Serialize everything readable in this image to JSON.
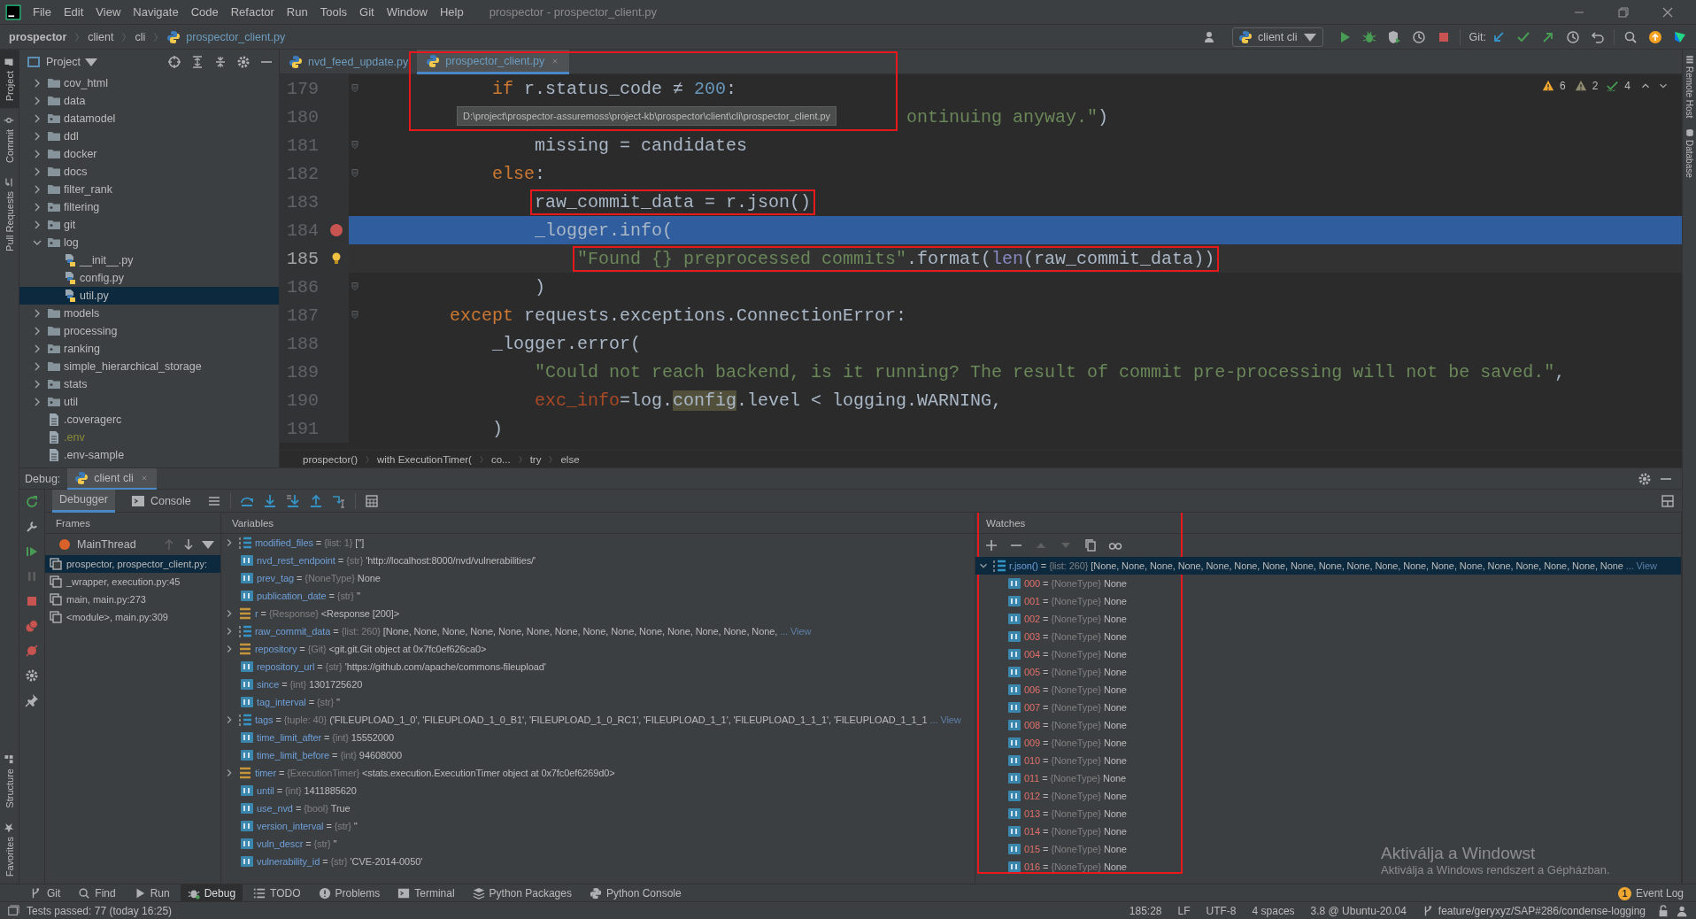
{
  "menu": [
    "File",
    "Edit",
    "View",
    "Navigate",
    "Code",
    "Refactor",
    "Run",
    "Tools",
    "Git",
    "Window",
    "Help"
  ],
  "window_title": "prospector - prospector_client.py",
  "nav": {
    "crumbs": [
      "prospector",
      "client",
      "cli",
      "prospector_client.py"
    ],
    "run_config": "client cli",
    "git_label": "Git:"
  },
  "left_strip": {
    "top": [
      {
        "label": "Project",
        "selected": true
      },
      {
        "label": "Commit",
        "selected": false
      },
      {
        "label": "Pull Requests",
        "selected": false
      }
    ],
    "bottom": [
      {
        "label": "Structure",
        "selected": false
      },
      {
        "label": "Favorites",
        "selected": false
      }
    ]
  },
  "right_strip": [
    "Remote Host",
    "Database"
  ],
  "project": {
    "title": "Project",
    "tree": [
      {
        "label": "cov_html",
        "kind": "folder",
        "expanded": false,
        "selected": false
      },
      {
        "label": "data",
        "kind": "folder",
        "expanded": false,
        "selected": false
      },
      {
        "label": "datamodel",
        "kind": "package",
        "expanded": false,
        "selected": false
      },
      {
        "label": "ddl",
        "kind": "folder",
        "expanded": false,
        "selected": false
      },
      {
        "label": "docker",
        "kind": "folder",
        "expanded": false,
        "selected": false
      },
      {
        "label": "docs",
        "kind": "folder",
        "expanded": false,
        "selected": false
      },
      {
        "label": "filter_rank",
        "kind": "folder",
        "expanded": false,
        "selected": false
      },
      {
        "label": "filtering",
        "kind": "package",
        "expanded": false,
        "selected": false
      },
      {
        "label": "git",
        "kind": "package",
        "expanded": false,
        "selected": false
      },
      {
        "label": "log",
        "kind": "package",
        "expanded": true,
        "selected": false,
        "children": [
          {
            "label": "__init__.py",
            "kind": "python",
            "selected": false
          },
          {
            "label": "config.py",
            "kind": "python",
            "selected": false
          },
          {
            "label": "util.py",
            "kind": "python",
            "selected": true
          }
        ]
      },
      {
        "label": "models",
        "kind": "folder",
        "expanded": false,
        "selected": false
      },
      {
        "label": "processing",
        "kind": "folder",
        "expanded": false,
        "selected": false
      },
      {
        "label": "ranking",
        "kind": "package",
        "expanded": false,
        "selected": false
      },
      {
        "label": "simple_hierarchical_storage",
        "kind": "folder",
        "expanded": false,
        "selected": false
      },
      {
        "label": "stats",
        "kind": "package",
        "expanded": false,
        "selected": false
      },
      {
        "label": "util",
        "kind": "package",
        "expanded": false,
        "selected": false
      },
      {
        "label": ".coveragerc",
        "kind": "file",
        "ignored": false,
        "selected": false
      },
      {
        "label": ".env",
        "kind": "file",
        "ignored": true,
        "selected": false
      },
      {
        "label": ".env-sample",
        "kind": "file",
        "ignored": false,
        "selected": false
      }
    ]
  },
  "editor": {
    "tabs": [
      {
        "label": "nvd_feed_update.py",
        "selected": false
      },
      {
        "label": "prospector_client.py",
        "selected": true
      }
    ],
    "tooltip": {
      "text": "D:\\project\\prospector-assuremoss\\project-kb\\prospector\\client\\cli\\prospector_client.py",
      "boxed": true
    },
    "inspections": [
      {
        "kind": "warning",
        "count": "6"
      },
      {
        "kind": "weak",
        "count": "2"
      },
      {
        "kind": "typo",
        "count": "4"
      }
    ],
    "lines": [
      {
        "number": "179",
        "kind": "level-3",
        "tokens": [
          {
            "kind": "keyword",
            "text": "if"
          },
          {
            "kind": "plain",
            "text": " r.status_code ≠ "
          },
          {
            "kind": "number",
            "text": "200"
          },
          {
            "kind": "plain",
            "text": ":"
          }
        ],
        "fold": true,
        "breakpoint": false,
        "current": false,
        "caret": false,
        "bulb": false,
        "boxed": false
      },
      {
        "number": "180",
        "kind": "after-tooltip",
        "tokens": [
          {
            "kind": "string",
            "text": "ontinuing anyway.\""
          },
          {
            "kind": "plain",
            "text": ")"
          }
        ],
        "fold": false,
        "breakpoint": false,
        "current": false,
        "caret": false,
        "bulb": false,
        "boxed": false
      },
      {
        "number": "181",
        "kind": "level-4",
        "tokens": [
          {
            "kind": "plain",
            "text": "missing = candidates"
          }
        ],
        "fold": true,
        "breakpoint": false,
        "current": false,
        "caret": false,
        "bulb": false,
        "boxed": false
      },
      {
        "number": "182",
        "kind": "level-3",
        "tokens": [
          {
            "kind": "keyword",
            "text": "else"
          },
          {
            "kind": "plain",
            "text": ":"
          }
        ],
        "fold": true,
        "breakpoint": false,
        "current": false,
        "caret": false,
        "bulb": false,
        "boxed": false
      },
      {
        "number": "183",
        "kind": "level-4",
        "tokens": [
          {
            "kind": "plain",
            "text": "raw_commit_data = r.json()"
          }
        ],
        "fold": false,
        "breakpoint": false,
        "current": false,
        "caret": false,
        "bulb": false,
        "boxed": true
      },
      {
        "number": "184",
        "kind": "level-4",
        "tokens": [
          {
            "kind": "plain",
            "text": "_logger.info("
          }
        ],
        "fold": false,
        "breakpoint": true,
        "current": true,
        "caret": false,
        "bulb": false,
        "boxed": false
      },
      {
        "number": "185",
        "kind": "level-5",
        "tokens": [
          {
            "kind": "string",
            "text": "\"Found {} preprocessed commits\""
          },
          {
            "kind": "plain",
            "text": ".format("
          },
          {
            "kind": "builtin",
            "text": "len"
          },
          {
            "kind": "plain",
            "text": "(raw_commit_data))"
          }
        ],
        "fold": false,
        "breakpoint": false,
        "current": false,
        "caret": true,
        "bulb": true,
        "boxed": true
      },
      {
        "number": "186",
        "kind": "level-4",
        "tokens": [
          {
            "kind": "plain",
            "text": ")"
          }
        ],
        "fold": true,
        "breakpoint": false,
        "current": false,
        "caret": false,
        "bulb": false,
        "boxed": false
      },
      {
        "number": "187",
        "kind": "level-2",
        "tokens": [
          {
            "kind": "keyword",
            "text": "except"
          },
          {
            "kind": "plain",
            "text": " requests.exceptions.ConnectionError:"
          }
        ],
        "fold": true,
        "breakpoint": false,
        "current": false,
        "caret": false,
        "bulb": false,
        "boxed": false
      },
      {
        "number": "188",
        "kind": "level-3",
        "tokens": [
          {
            "kind": "plain",
            "text": "_logger.error("
          }
        ],
        "fold": false,
        "breakpoint": false,
        "current": false,
        "caret": false,
        "bulb": false,
        "boxed": false
      },
      {
        "number": "189",
        "kind": "level-4",
        "tokens": [
          {
            "kind": "string",
            "text": "\"Could not reach backend, is it running? The result of commit pre-processing will not be saved.\""
          },
          {
            "kind": "plain",
            "text": ","
          }
        ],
        "fold": false,
        "breakpoint": false,
        "current": false,
        "caret": false,
        "bulb": false,
        "boxed": false
      },
      {
        "number": "190",
        "kind": "level-4",
        "tokens": [
          {
            "kind": "param",
            "text": "exc_info"
          },
          {
            "kind": "plain",
            "text": "=log."
          },
          {
            "kind": "usage",
            "text": "config"
          },
          {
            "kind": "plain",
            "text": ".level < logging.WARNING,"
          }
        ],
        "fold": false,
        "breakpoint": false,
        "current": false,
        "caret": false,
        "bulb": false,
        "boxed": false
      },
      {
        "number": "191",
        "kind": "level-3",
        "tokens": [
          {
            "kind": "plain",
            "text": ")"
          }
        ],
        "fold": false,
        "breakpoint": false,
        "current": false,
        "caret": false,
        "bulb": false,
        "boxed": false
      }
    ],
    "breadcrumbs": [
      "prospector()",
      "with ExecutionTimer(",
      "co...",
      "try",
      "else"
    ]
  },
  "debug": {
    "label": "Debug:",
    "session": "client cli",
    "tabs": [
      {
        "label": "Debugger",
        "selected": true
      },
      {
        "label": "Console",
        "selected": false
      }
    ],
    "frames_title": "Frames",
    "thread": "MainThread",
    "frames": [
      {
        "label": "prospector, prospector_client.py:",
        "selected": true
      },
      {
        "label": "_wrapper, execution.py:45",
        "selected": false
      },
      {
        "label": "main, main.py:273",
        "selected": false
      },
      {
        "label": "<module>, main.py:309",
        "selected": false
      }
    ],
    "variables_title": "Variables",
    "variables": [
      {
        "name": "modified_files",
        "op": "=",
        "type": "{list: 1}",
        "value": "['']",
        "kind": "list",
        "expandable": true
      },
      {
        "name": "nvd_rest_endpoint",
        "op": "=",
        "type": "{str}",
        "value": "'http://localhost:8000/nvd/vulnerabilities/'",
        "kind": "num",
        "expandable": false
      },
      {
        "name": "prev_tag",
        "op": "=",
        "type": "{NoneType}",
        "value": "None",
        "kind": "num",
        "expandable": false
      },
      {
        "name": "publication_date",
        "op": "=",
        "type": "{str}",
        "value": "''",
        "kind": "num",
        "expandable": false
      },
      {
        "name": "r",
        "op": "=",
        "type": "{Response}",
        "value": "<Response [200]>",
        "kind": "obj",
        "expandable": true
      },
      {
        "name": "raw_commit_data",
        "op": "=",
        "type": "{list: 260}",
        "value": "[None, None, None, None, None, None, None, None, None, None, None, None, None, None,",
        "view": "... View",
        "kind": "list",
        "expandable": true
      },
      {
        "name": "repository",
        "op": "=",
        "type": "{Git}",
        "value": "<git.git.Git object at 0x7fc0ef626ca0>",
        "kind": "obj",
        "expandable": true
      },
      {
        "name": "repository_url",
        "op": "=",
        "type": "{str}",
        "value": "'https://github.com/apache/commons-fileupload'",
        "kind": "num",
        "expandable": false
      },
      {
        "name": "since",
        "op": "=",
        "type": "{int}",
        "value": "1301725620",
        "kind": "num",
        "expandable": false
      },
      {
        "name": "tag_interval",
        "op": "=",
        "type": "{str}",
        "value": "''",
        "kind": "num",
        "expandable": false
      },
      {
        "name": "tags",
        "op": "=",
        "type": "{tuple: 40}",
        "value": "('FILEUPLOAD_1_0', 'FILEUPLOAD_1_0_B1', 'FILEUPLOAD_1_0_RC1', 'FILEUPLOAD_1_1', 'FILEUPLOAD_1_1_1', 'FILEUPLOAD_1_1_1",
        "view": "... View",
        "kind": "list",
        "expandable": true
      },
      {
        "name": "time_limit_after",
        "op": "=",
        "type": "{int}",
        "value": "15552000",
        "kind": "num",
        "expandable": false
      },
      {
        "name": "time_limit_before",
        "op": "=",
        "type": "{int}",
        "value": "94608000",
        "kind": "num",
        "expandable": false
      },
      {
        "name": "timer",
        "op": "=",
        "type": "{ExecutionTimer}",
        "value": "<stats.execution.ExecutionTimer object at 0x7fc0ef6269d0>",
        "kind": "obj",
        "expandable": true
      },
      {
        "name": "until",
        "op": "=",
        "type": "{int}",
        "value": "1411885620",
        "kind": "num",
        "expandable": false
      },
      {
        "name": "use_nvd",
        "op": "=",
        "type": "{bool}",
        "value": "True",
        "kind": "num",
        "expandable": false
      },
      {
        "name": "version_interval",
        "op": "=",
        "type": "{str}",
        "value": "''",
        "kind": "num",
        "expandable": false
      },
      {
        "name": "vuln_descr",
        "op": "=",
        "type": "{str}",
        "value": "''",
        "kind": "num",
        "expandable": false
      },
      {
        "name": "vulnerability_id",
        "op": "=",
        "type": "{str}",
        "value": "'CVE-2014-0050'",
        "kind": "num",
        "expandable": false
      }
    ],
    "watches": {
      "title": "Watches",
      "boxed": true,
      "root": {
        "name": "r.json()",
        "op": "=",
        "type": "{list: 260}",
        "value": "[None, None, None, None, None, None, None, None, None, None, None, None, None, None, None, None, None, None, None",
        "view": "... View",
        "kind": "list",
        "expanded": true,
        "selected": true
      },
      "children": [
        {
          "name": "000",
          "op": "=",
          "type": "{NoneType}",
          "value": "None"
        },
        {
          "name": "001",
          "op": "=",
          "type": "{NoneType}",
          "value": "None"
        },
        {
          "name": "002",
          "op": "=",
          "type": "{NoneType}",
          "value": "None"
        },
        {
          "name": "003",
          "op": "=",
          "type": "{NoneType}",
          "value": "None"
        },
        {
          "name": "004",
          "op": "=",
          "type": "{NoneType}",
          "value": "None"
        },
        {
          "name": "005",
          "op": "=",
          "type": "{NoneType}",
          "value": "None"
        },
        {
          "name": "006",
          "op": "=",
          "type": "{NoneType}",
          "value": "None"
        },
        {
          "name": "007",
          "op": "=",
          "type": "{NoneType}",
          "value": "None"
        },
        {
          "name": "008",
          "op": "=",
          "type": "{NoneType}",
          "value": "None"
        },
        {
          "name": "009",
          "op": "=",
          "type": "{NoneType}",
          "value": "None"
        },
        {
          "name": "010",
          "op": "=",
          "type": "{NoneType}",
          "value": "None"
        },
        {
          "name": "011",
          "op": "=",
          "type": "{NoneType}",
          "value": "None"
        },
        {
          "name": "012",
          "op": "=",
          "type": "{NoneType}",
          "value": "None"
        },
        {
          "name": "013",
          "op": "=",
          "type": "{NoneType}",
          "value": "None"
        },
        {
          "name": "014",
          "op": "=",
          "type": "{NoneType}",
          "value": "None"
        },
        {
          "name": "015",
          "op": "=",
          "type": "{NoneType}",
          "value": "None"
        },
        {
          "name": "016",
          "op": "=",
          "type": "{NoneType}",
          "value": "None"
        }
      ]
    }
  },
  "tool_windows": [
    {
      "label": "Git",
      "kind": "git",
      "selected": false
    },
    {
      "label": "Find",
      "kind": "find",
      "selected": false
    },
    {
      "label": "Run",
      "kind": "run",
      "selected": false
    },
    {
      "label": "Debug",
      "kind": "debug",
      "selected": true
    },
    {
      "label": "TODO",
      "kind": "todo",
      "selected": false
    },
    {
      "label": "Problems",
      "kind": "problems",
      "selected": false
    },
    {
      "label": "Terminal",
      "kind": "terminal",
      "selected": false
    },
    {
      "label": "Python Packages",
      "kind": "packages",
      "selected": false
    },
    {
      "label": "Python Console",
      "kind": "pyconsole",
      "selected": false
    }
  ],
  "event_log": {
    "label": "Event Log",
    "badge": "1"
  },
  "status": {
    "message": "Tests passed: 77 (today 16:25)",
    "items": [
      "185:28",
      "LF",
      "UTF-8",
      "4 spaces",
      "3.8 @ Ubuntu-20.04"
    ],
    "branch": "feature/geryxyz/SAP#286/condense-logging"
  },
  "os_notice": {
    "title": "Aktiválja a Windowst",
    "text": "Aktiválja a Windows rendszert a Gépházban."
  }
}
